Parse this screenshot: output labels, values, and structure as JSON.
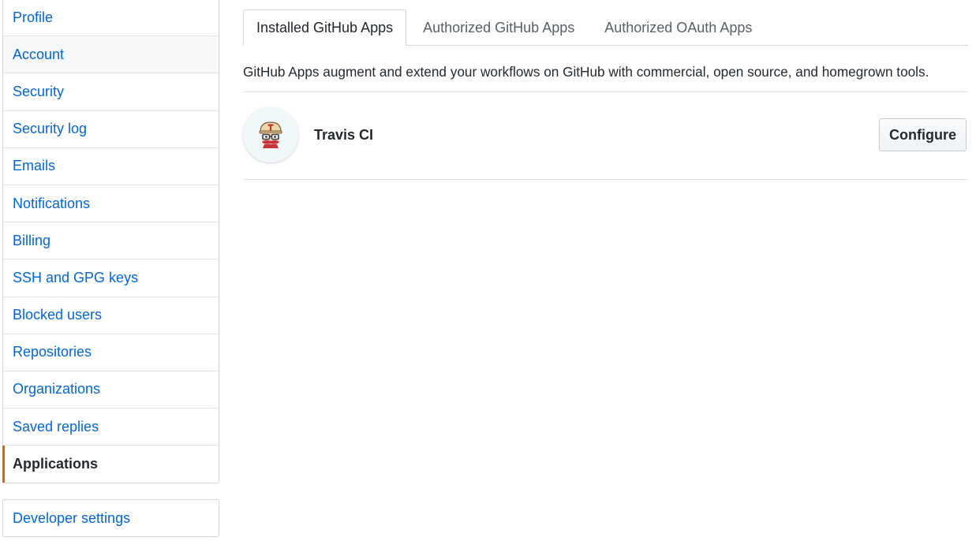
{
  "sidebar": {
    "items": [
      {
        "label": "Profile"
      },
      {
        "label": "Account"
      },
      {
        "label": "Security"
      },
      {
        "label": "Security log"
      },
      {
        "label": "Emails"
      },
      {
        "label": "Notifications"
      },
      {
        "label": "Billing"
      },
      {
        "label": "SSH and GPG keys"
      },
      {
        "label": "Blocked users"
      },
      {
        "label": "Repositories"
      },
      {
        "label": "Organizations"
      },
      {
        "label": "Saved replies"
      },
      {
        "label": "Applications"
      }
    ],
    "selected": "Applications",
    "hovered": "Account",
    "developer_settings": "Developer settings"
  },
  "tabs": [
    {
      "label": "Installed GitHub Apps"
    },
    {
      "label": "Authorized GitHub Apps"
    },
    {
      "label": "Authorized OAuth Apps"
    }
  ],
  "description": "GitHub Apps augment and extend your workflows on GitHub with commercial, open source, and homegrown tools.",
  "apps": [
    {
      "name": "Travis CI",
      "icon": "travis-ci-mascot-icon",
      "action_label": "Configure"
    }
  ],
  "colors": {
    "link": "#0366d6",
    "selected_indicator": "#e36209",
    "border": "#d1d5da"
  }
}
